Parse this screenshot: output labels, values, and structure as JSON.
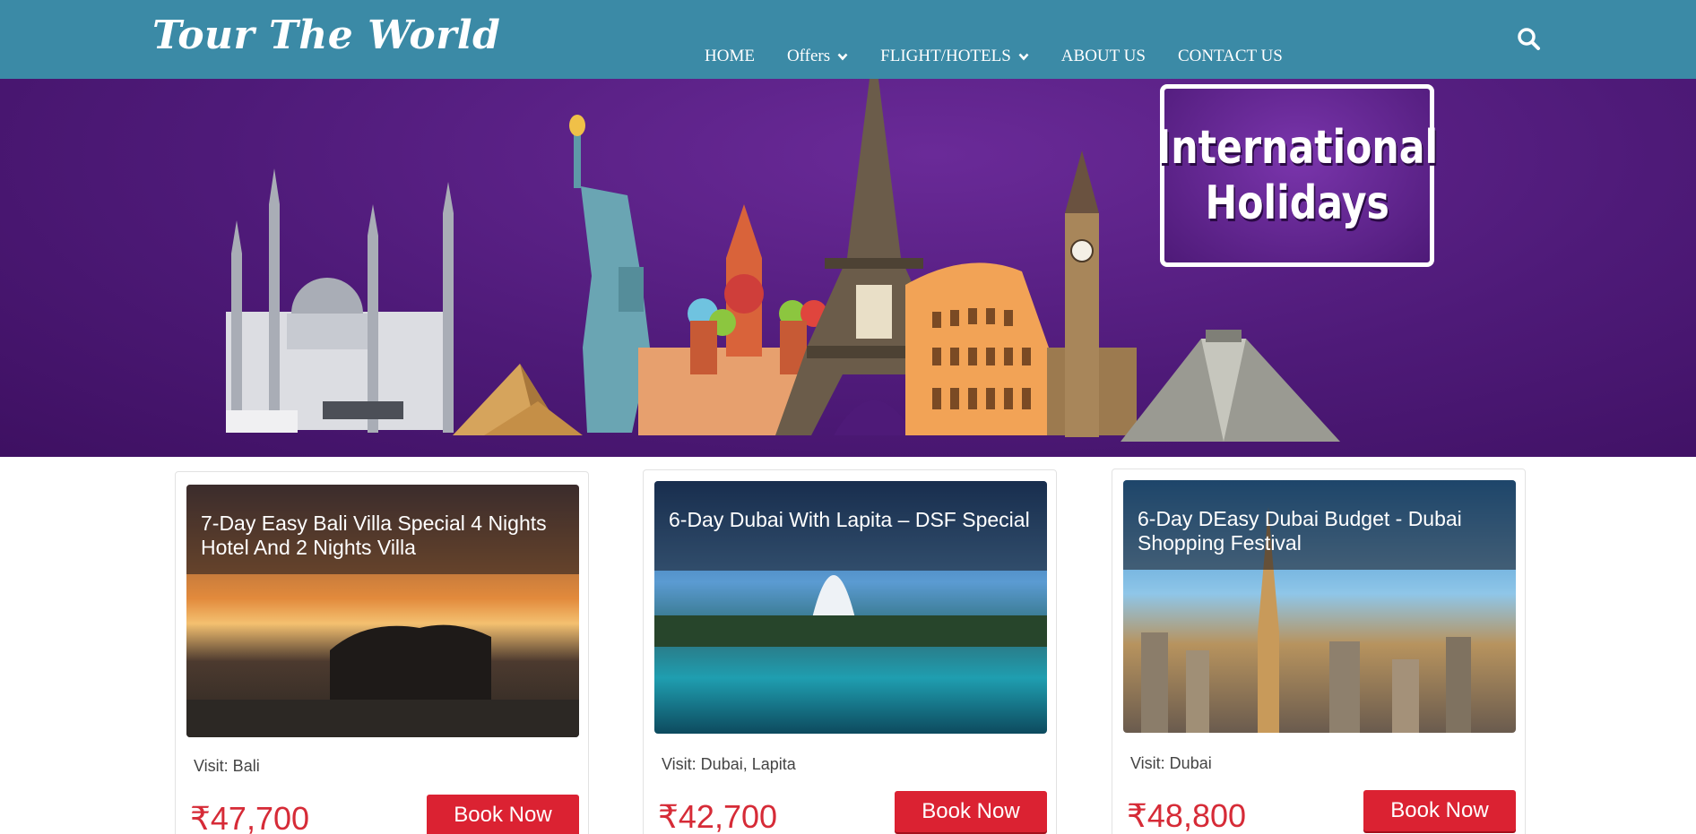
{
  "header": {
    "logo": "Tour The World",
    "nav": [
      {
        "label": "HOME",
        "has_dropdown": false
      },
      {
        "label": "Offers",
        "has_dropdown": true
      },
      {
        "label": "FLIGHT/HOTELS",
        "has_dropdown": true
      },
      {
        "label": "ABOUT US",
        "has_dropdown": false
      },
      {
        "label": "CONTACT US",
        "has_dropdown": false
      }
    ],
    "search_icon": "search-icon"
  },
  "banner": {
    "line1": "International",
    "line2": "Holidays",
    "landmarks": [
      "blue-mosque",
      "pyramids",
      "statue-of-liberty",
      "st-basils-cathedral",
      "eiffel-tower",
      "colosseum",
      "big-ben",
      "chichen-itza"
    ]
  },
  "packages": [
    {
      "title": "7-Day Easy Bali Villa Special 4 Nights Hotel And 2 Nights Villa",
      "visit": "Visit: Bali",
      "price": "₹47,700",
      "cta": "Book Now"
    },
    {
      "title": "6-Day Dubai With Lapita – DSF Special",
      "visit": "Visit: Dubai, Lapita",
      "price": "₹42,700",
      "cta": "Book Now"
    },
    {
      "title": "6-Day DEasy Dubai Budget - Dubai Shopping Festival",
      "visit": "Visit: Dubai",
      "price": "₹48,800",
      "cta": "Book Now"
    }
  ],
  "colors": {
    "header": "#3b8aa6",
    "banner": "#4e1a78",
    "price": "#d62b37",
    "button": "#db2232"
  }
}
